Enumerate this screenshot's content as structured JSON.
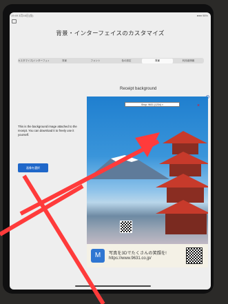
{
  "statusbar": {
    "left": "19:49 3月16日(金)",
    "right": "●●● 98%"
  },
  "title": "背景・インターフェイスのカスタマイズ",
  "tabs": [
    {
      "label": "カスタマイズ(インターフェイス背景など)"
    },
    {
      "label": "背景"
    },
    {
      "label": "フォント"
    },
    {
      "label": "色の設定"
    },
    {
      "label": "背景"
    },
    {
      "label": "利用者情報"
    }
  ],
  "section": {
    "title": "Receipt background"
  },
  "description": "This is the background image attached to the receipt. You can download it to freely use it yourself.",
  "select_button": "画像を選択",
  "preview": {
    "overlay_label": "Shop: 9631 (1234) ×",
    "close_mark": "×",
    "ad_line1": "写真を3Dでたくさんの笑顔を!",
    "ad_line2": "https://www.9631.co.jp/",
    "logo_text": "M"
  },
  "colors": {
    "accent": "#1f67c9",
    "annotation": "#ff3b3b"
  },
  "icons": {
    "help": "help-icon",
    "sidebar": "sidebar-icon"
  }
}
